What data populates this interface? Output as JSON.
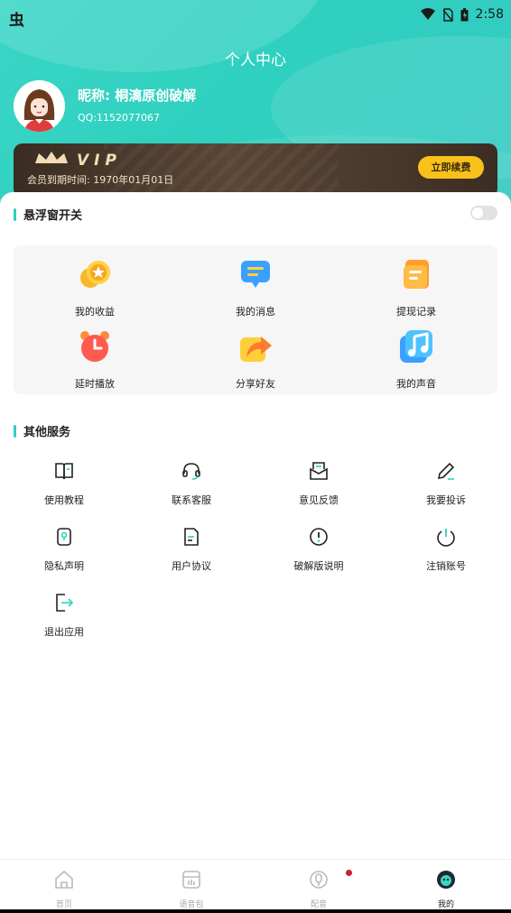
{
  "status_bar": {
    "app_glyph": "虫",
    "time": "2:58"
  },
  "header": {
    "title": "个人中心"
  },
  "profile": {
    "nickname": "昵称: 桐漓原创破解",
    "qq": "QQ:1152077067"
  },
  "vip": {
    "badge": "VIP",
    "expire_text": "会员到期时间: 1970年01月01日",
    "renew_label": "立即续费"
  },
  "float_window": {
    "title": "悬浮窗开关",
    "enabled": false
  },
  "features": [
    {
      "label": "我的收益",
      "icon": "coin-icon"
    },
    {
      "label": "我的消息",
      "icon": "message-icon"
    },
    {
      "label": "提现记录",
      "icon": "record-icon"
    },
    {
      "label": "延时播放",
      "icon": "alarm-icon"
    },
    {
      "label": "分享好友",
      "icon": "share-icon"
    },
    {
      "label": "我的声音",
      "icon": "music-icon"
    }
  ],
  "other_services": {
    "title": "其他服务",
    "items": [
      {
        "label": "使用教程",
        "icon": "book-icon"
      },
      {
        "label": "联系客服",
        "icon": "headset-icon"
      },
      {
        "label": "意见反馈",
        "icon": "feedback-icon"
      },
      {
        "label": "我要投诉",
        "icon": "pencil-icon"
      },
      {
        "label": "隐私声明",
        "icon": "privacy-icon"
      },
      {
        "label": "用户协议",
        "icon": "document-icon"
      },
      {
        "label": "破解版说明",
        "icon": "info-icon"
      },
      {
        "label": "注销账号",
        "icon": "power-icon"
      },
      {
        "label": "退出应用",
        "icon": "exit-icon"
      }
    ]
  },
  "tabbar": [
    {
      "label": "首页",
      "icon": "home-icon",
      "active": false
    },
    {
      "label": "语音包",
      "icon": "voice-pack-icon",
      "active": false
    },
    {
      "label": "配音",
      "icon": "microphone-icon",
      "active": false,
      "badge_dot": true
    },
    {
      "label": "我的",
      "icon": "profile-icon",
      "active": true
    }
  ],
  "colors": {
    "accent": "#2fd0bf",
    "vip_gold": "#f9c21a",
    "vip_bg": "#3a2c22"
  }
}
